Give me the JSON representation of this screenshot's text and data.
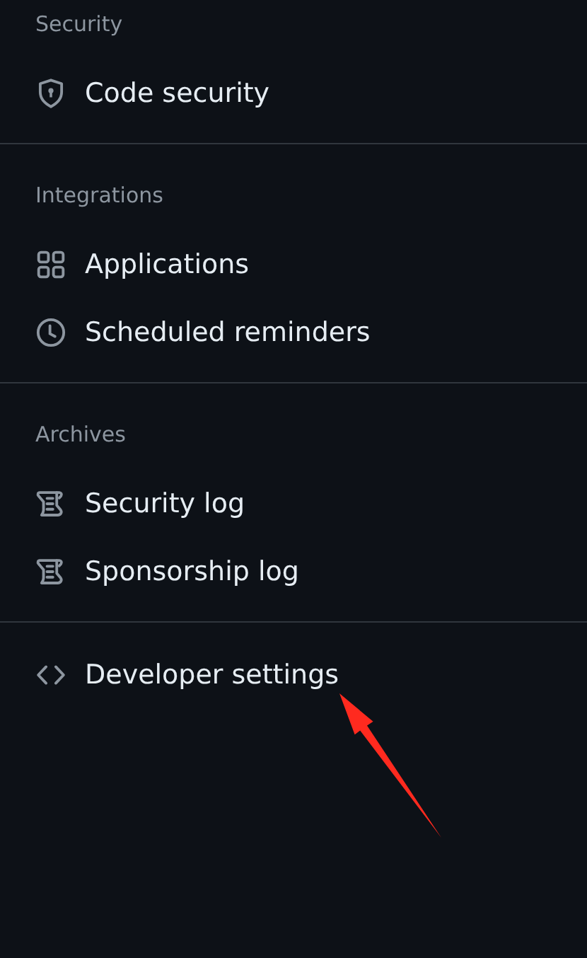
{
  "sections": [
    {
      "title": "Security",
      "items": [
        {
          "label": "Code security",
          "kind": "shield"
        }
      ]
    },
    {
      "title": "Integrations",
      "items": [
        {
          "label": "Applications",
          "kind": "apps"
        },
        {
          "label": "Scheduled reminders",
          "kind": "clock"
        }
      ]
    },
    {
      "title": "Archives",
      "items": [
        {
          "label": "Security log",
          "kind": "log"
        },
        {
          "label": "Sponsorship log",
          "kind": "log"
        }
      ]
    },
    {
      "items": [
        {
          "label": "Developer settings",
          "kind": "code"
        }
      ]
    }
  ]
}
